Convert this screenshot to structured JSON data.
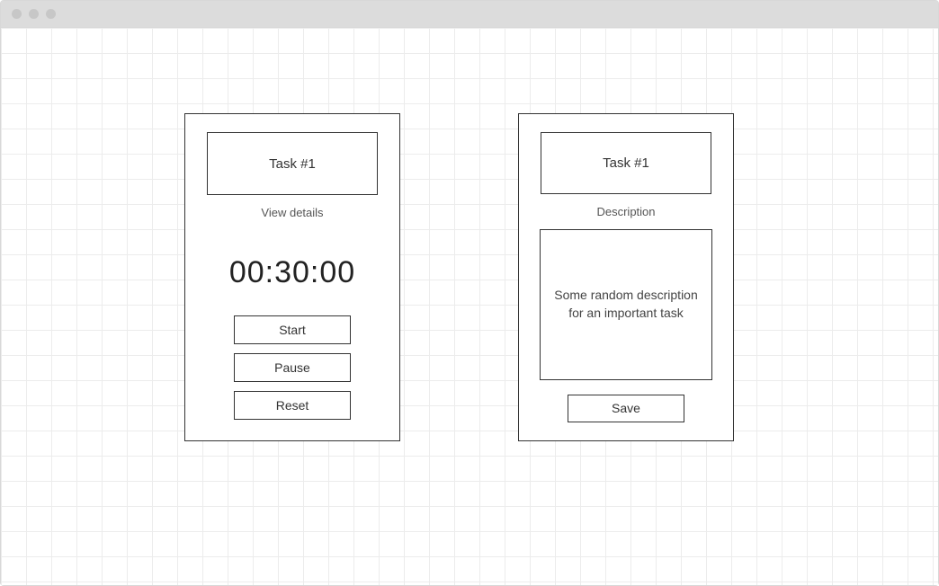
{
  "leftCard": {
    "title": "Task #1",
    "subtext": "View details",
    "timer": "00:30:00",
    "buttons": {
      "start": "Start",
      "pause": "Pause",
      "reset": "Reset"
    }
  },
  "rightCard": {
    "title": "Task #1",
    "subtext": "Description",
    "description": "Some random description for an important task",
    "buttons": {
      "save": "Save"
    }
  }
}
